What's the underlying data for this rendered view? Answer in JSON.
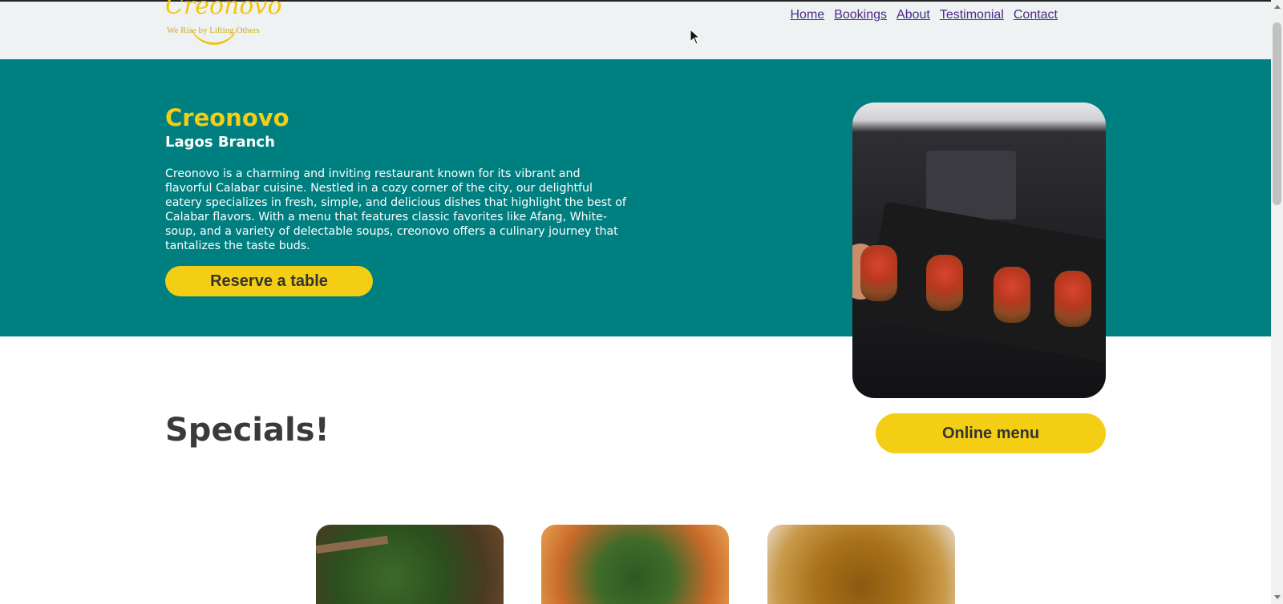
{
  "brand": {
    "logo_text": "Creonovo",
    "tagline": "We Rise by Lifting Others"
  },
  "nav": {
    "items": [
      "Home",
      "Bookings",
      "About",
      "Testimonial",
      "Contact"
    ]
  },
  "hero": {
    "title": "Creonovo",
    "subtitle": "Lagos Branch",
    "description": "Creonovo is a charming and inviting restaurant known for its vibrant and flavorful Calabar cuisine. Nestled in a cozy corner of the city, our delightful eatery specializes in fresh, simple, and delicious dishes that highlight the best of Calabar flavors. With a menu that features classic favorites like Afang, White-soup, and a variety of delectable soups, creonovo offers a culinary journey that tantalizes the taste buds.",
    "cta_label": "Reserve a table"
  },
  "specials": {
    "title": "Specials!",
    "menu_button": "Online menu"
  },
  "colors": {
    "hero_bg": "#007f80",
    "accent_yellow": "#f4ce14",
    "nav_link": "#4b2a8a"
  }
}
